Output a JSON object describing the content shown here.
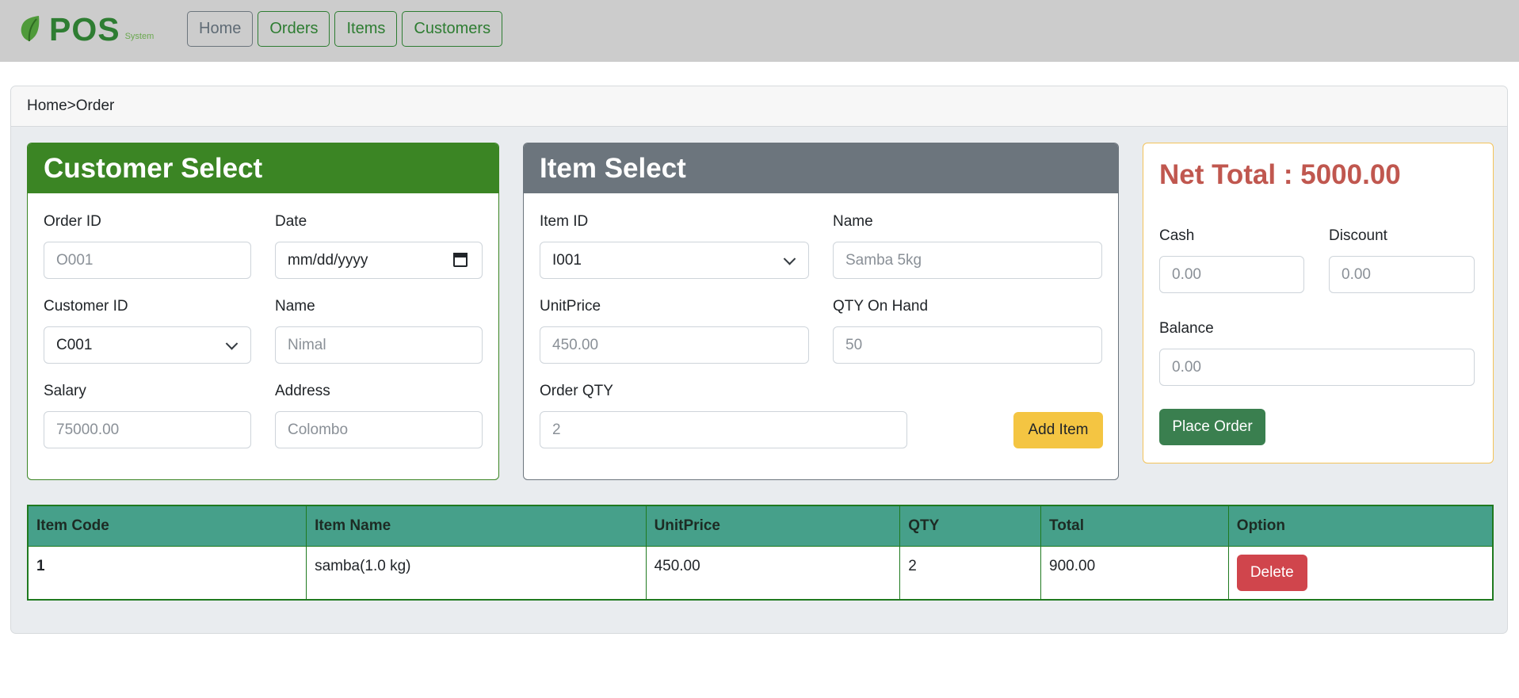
{
  "brand": {
    "name": "POS",
    "subtitle": "System"
  },
  "nav": {
    "home": "Home",
    "orders": "Orders",
    "items": "Items",
    "customers": "Customers"
  },
  "breadcrumb": "Home>Order",
  "customer_select": {
    "title": "Customer Select",
    "order_id": {
      "label": "Order ID",
      "placeholder": "O001"
    },
    "date": {
      "label": "Date",
      "placeholder": "mm/dd/yyyy"
    },
    "customer_id": {
      "label": "Customer ID",
      "value": "C001"
    },
    "name": {
      "label": "Name",
      "value": "Nimal"
    },
    "salary": {
      "label": "Salary",
      "value": "75000.00"
    },
    "address": {
      "label": "Address",
      "value": "Colombo"
    }
  },
  "item_select": {
    "title": "Item Select",
    "item_id": {
      "label": "Item ID",
      "value": "I001"
    },
    "name": {
      "label": "Name",
      "value": "Samba 5kg"
    },
    "unit_price": {
      "label": "UnitPrice",
      "value": "450.00"
    },
    "qty_on_hand": {
      "label": "QTY On Hand",
      "value": "50"
    },
    "order_qty": {
      "label": "Order QTY",
      "value": "2"
    },
    "add_button": "Add Item"
  },
  "totals": {
    "net_total": "Net Total : 5000.00",
    "cash": {
      "label": "Cash",
      "placeholder": "0.00"
    },
    "discount": {
      "label": "Discount",
      "placeholder": "0.00"
    },
    "balance": {
      "label": "Balance",
      "placeholder": "0.00"
    },
    "place_order_button": "Place Order"
  },
  "cart": {
    "columns": [
      "Item Code",
      "Item Name",
      "UnitPrice",
      "QTY",
      "Total",
      "Option"
    ],
    "rows": [
      {
        "code": "1",
        "name": "samba(1.0 kg)",
        "unit_price": "450.00",
        "qty": "2",
        "total": "900.00",
        "option": "Delete"
      }
    ]
  },
  "colors": {
    "brand_green": "#2e7d32",
    "customer_header": "#3b8524",
    "item_header": "#6c757d",
    "net_total": "#c0574f",
    "table_header": "#46a08a",
    "add_button": "#f4c542",
    "place_order_button": "#3a7f4f",
    "delete_button": "#d0454c"
  }
}
